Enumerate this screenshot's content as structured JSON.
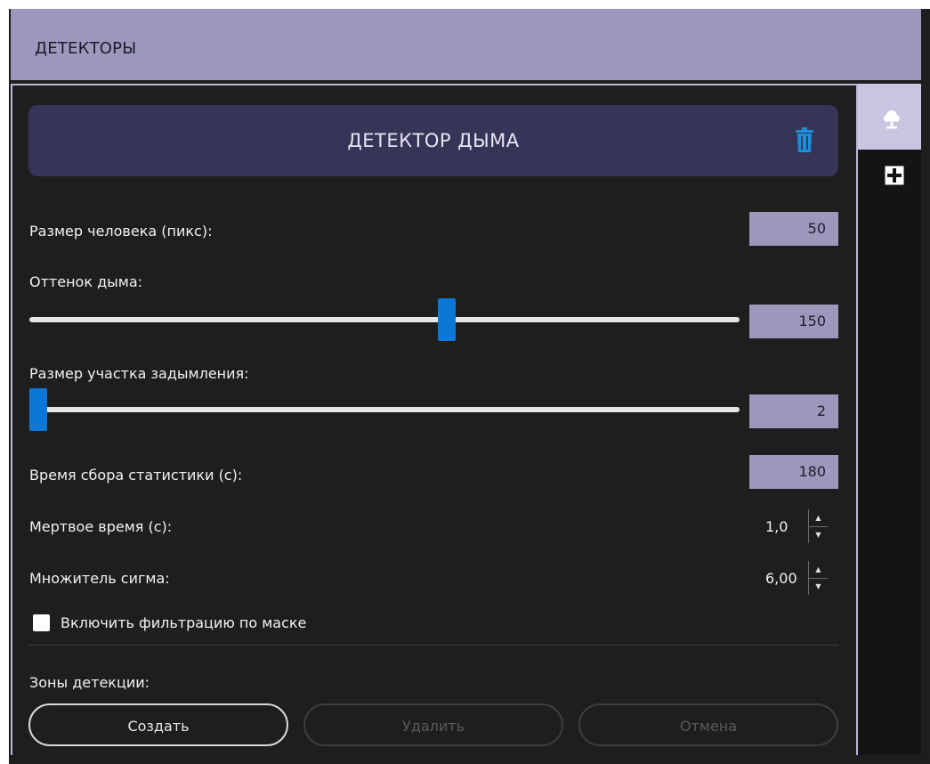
{
  "header": {
    "title": "ДЕТЕКТОРЫ"
  },
  "side_tabs": [
    {
      "icon": "tree-icon",
      "active": true
    },
    {
      "icon": "plus-icon",
      "active": false
    }
  ],
  "detector": {
    "title": "ДЕТЕКТОР ДЫМА",
    "delete_icon": "trash-icon",
    "accent_color": "#1a8fdc"
  },
  "fields": {
    "person_size": {
      "label": "Размер человека (пикс):",
      "value": "50"
    },
    "smoke_shade": {
      "label": "Оттенок дыма:",
      "value": "150",
      "level": 0.59
    },
    "smoke_area": {
      "label": "Размер участка задымления:",
      "value": "2",
      "level": 0.0
    },
    "stats_time": {
      "label": "Время сбора статистики (с):",
      "value": "180"
    },
    "dead_time": {
      "label": "Мертвое время (с):",
      "value": "1,0"
    },
    "sigma": {
      "label": "Множитель сигма:",
      "value": "6,00"
    }
  },
  "mask_filter": {
    "label": "Включить фильтрацию по маске",
    "checked": false
  },
  "zones": {
    "label": "Зоны детекции:",
    "buttons": [
      {
        "label": "Создать",
        "enabled": true
      },
      {
        "label": "Удалить",
        "enabled": false
      },
      {
        "label": "Отмена",
        "enabled": false
      }
    ]
  }
}
